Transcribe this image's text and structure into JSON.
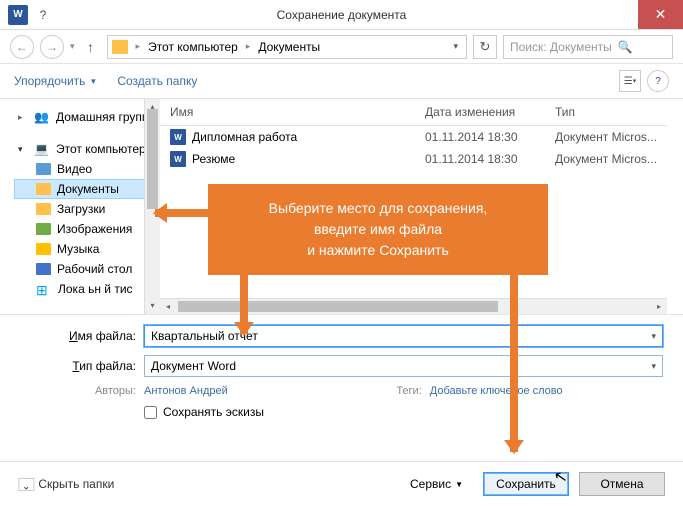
{
  "window": {
    "title": "Сохранение документа",
    "app_icon_text": "W"
  },
  "breadcrumb": {
    "level1": "Этот компьютер",
    "level2": "Документы"
  },
  "search": {
    "placeholder": "Поиск: Документы"
  },
  "toolbar": {
    "organize": "Упорядочить",
    "new_folder": "Создать папку"
  },
  "sidebar": {
    "homegroup": "Домашняя группа",
    "computer": "Этот компьютер",
    "items": [
      {
        "label": "Видео",
        "icon": "video"
      },
      {
        "label": "Документы",
        "icon": "folder",
        "selected": true
      },
      {
        "label": "Загрузки",
        "icon": "folder"
      },
      {
        "label": "Изображения",
        "icon": "images"
      },
      {
        "label": "Музыка",
        "icon": "music"
      },
      {
        "label": "Рабочий стол",
        "icon": "desktop"
      },
      {
        "label": "Локальный диск",
        "icon": "disk",
        "truncated": "Лока ьн й тис"
      }
    ]
  },
  "columns": {
    "name": "Имя",
    "date": "Дата изменения",
    "type": "Тип"
  },
  "files": [
    {
      "name": "Дипломная работа",
      "date": "01.11.2014 18:30",
      "type": "Документ Micros..."
    },
    {
      "name": "Резюме",
      "date": "01.11.2014 18:30",
      "type": "Документ Micros..."
    }
  ],
  "form": {
    "filename_label": "Имя файла:",
    "filename_value": "Квартальный отчет",
    "filetype_label": "Тип файла:",
    "filetype_value": "Документ Word",
    "authors_label": "Авторы:",
    "authors_value": "Антонов Андрей",
    "tags_label": "Теги:",
    "tags_value": "Добавьте ключевое слово",
    "save_thumbs": "Сохранять эскизы"
  },
  "footer": {
    "hide_folders": "Скрыть папки",
    "tools": "Сервис",
    "save": "Сохранить",
    "cancel": "Отмена"
  },
  "callout": {
    "line1": "Выберите место для сохранения,",
    "line2": "введите имя файла",
    "line3": "и нажмите Сохранить"
  }
}
